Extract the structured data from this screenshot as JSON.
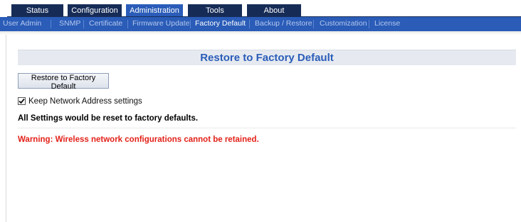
{
  "tabs": [
    {
      "label": "Status",
      "active": false
    },
    {
      "label": "Configuration",
      "active": false
    },
    {
      "label": "Administration",
      "active": true
    },
    {
      "label": "Tools",
      "active": false
    },
    {
      "label": "About",
      "active": false
    }
  ],
  "subnav": [
    {
      "label": "User Admin",
      "active": false
    },
    {
      "label": "SNMP",
      "active": false
    },
    {
      "label": "Certificate",
      "active": false
    },
    {
      "label": "Firmware Update",
      "active": false
    },
    {
      "label": "Factory Default",
      "active": true
    },
    {
      "label": "Backup / Restore",
      "active": false
    },
    {
      "label": "Customization",
      "active": false
    },
    {
      "label": "License",
      "active": false
    }
  ],
  "main": {
    "title": "Restore to Factory Default",
    "restore_button_label": "Restore to Factory Default",
    "keep_network": {
      "label": "Keep Network Address settings",
      "checked": true
    },
    "reset_note": "All Settings would be reset to factory defaults.",
    "warning": "Warning: Wireless network configurations cannot be retained."
  },
  "colors": {
    "tab_bg": "#162c57",
    "tab_active_bg": "#2a5cb8",
    "subnav_bg": "#2a5cb8",
    "title_text": "#2a5cb8",
    "warning_text": "#e32119"
  },
  "icons": {
    "checkbox_checked": "check-icon"
  }
}
